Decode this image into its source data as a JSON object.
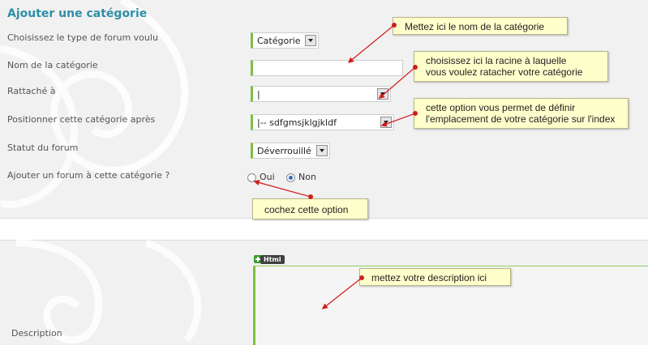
{
  "form": {
    "title": "Ajouter une catégorie",
    "rows": [
      {
        "label": "Choisissez le type de forum voulu"
      },
      {
        "label": "Nom de la catégorie"
      },
      {
        "label": "Rattaché à"
      },
      {
        "label": "Positionner cette catégorie après"
      },
      {
        "label": "Statut du forum"
      },
      {
        "label": "Ajouter un forum à cette catégorie ?"
      }
    ],
    "type_select": {
      "value": "Catégorie"
    },
    "name_input": {
      "value": ""
    },
    "parent_select": {
      "value": "|"
    },
    "position_select": {
      "value": "|-- sdfgmsjklgjkldf"
    },
    "status_select": {
      "value": "Déverrouillé"
    },
    "add_forum": {
      "options": [
        "Oui",
        "Non"
      ],
      "selected": "Non"
    },
    "description": {
      "label": "Description",
      "toolbar_label": "Html",
      "value": ""
    }
  },
  "annotations": [
    {
      "text": "Mettez ici le nom de la catégorie"
    },
    {
      "text_line1": "choisissez ici la racine à laquelle",
      "text_line2": "vous voulez ratacher votre catégorie"
    },
    {
      "text_line1": "cette option vous permet de définir",
      "text_line2": "l'emplacement de votre catégorie sur l'index"
    },
    {
      "text": "cochez cette option"
    },
    {
      "text": "mettez votre description ici"
    }
  ],
  "colors": {
    "title": "#2f8fa6",
    "accent_green": "#7bc043",
    "note_bg": "#ffffcc",
    "arrow_red": "#d11d1d",
    "radio_selected": "#2a6fbf"
  }
}
